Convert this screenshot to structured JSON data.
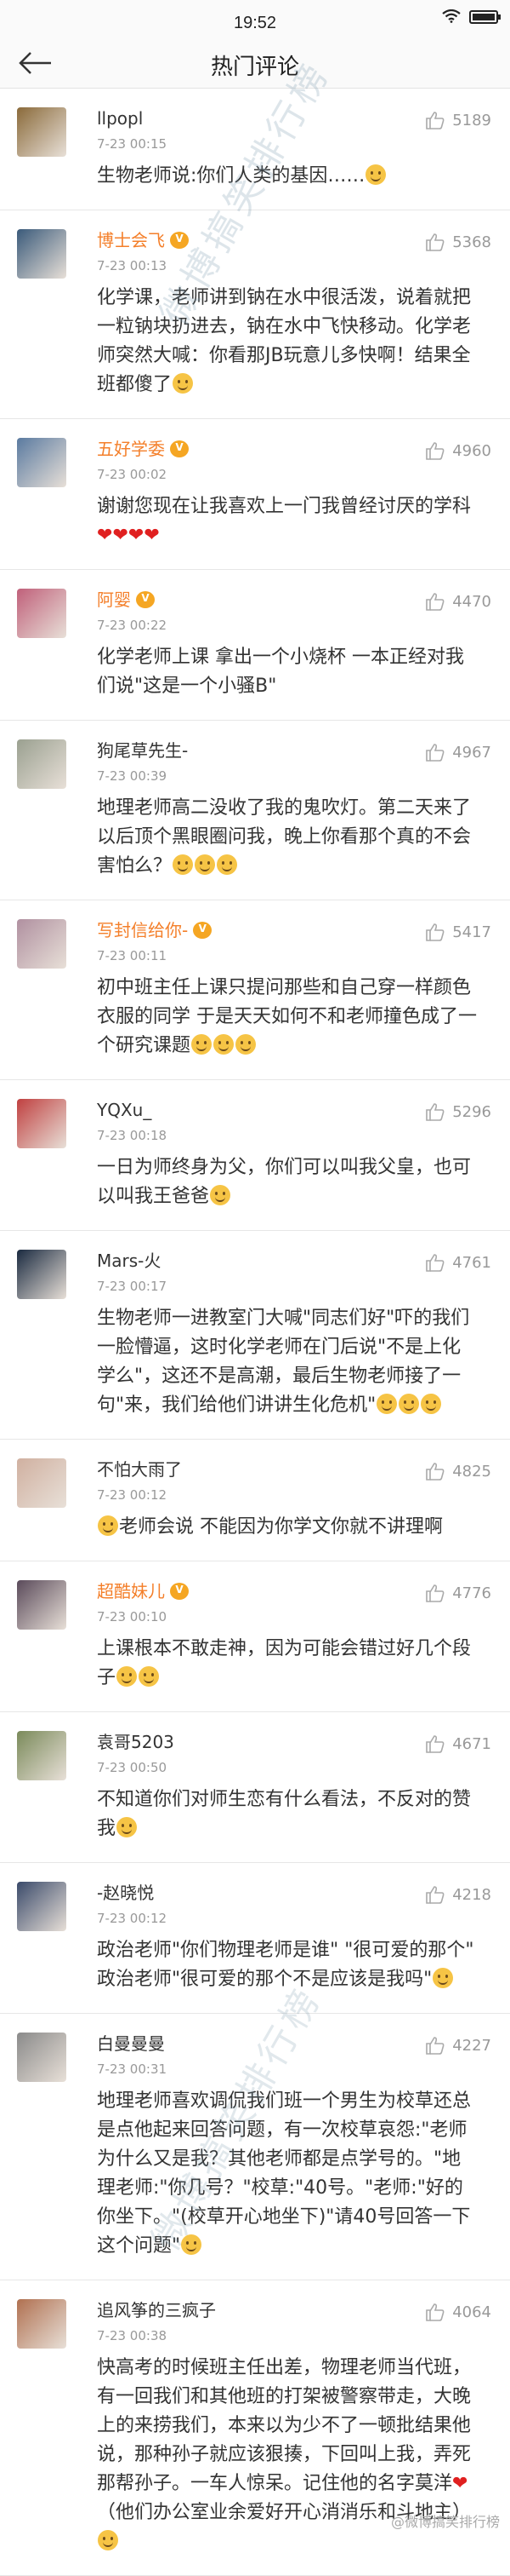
{
  "status": {
    "time": "19:52"
  },
  "header": {
    "title": "热门评论"
  },
  "watermark": {
    "text": "微博搞笑排行榜"
  },
  "footer": {
    "mark": "@微博搞笑排行榜"
  },
  "colors": {
    "vip_name": "#f47f2a",
    "heart": "#e02020"
  },
  "comments": [
    {
      "name": "llpopl",
      "vip": false,
      "time": "7-23 00:15",
      "likes": "5189",
      "text": "生物老师说:你们人类的基因……",
      "emoji_after": 1,
      "avatar_color": "#8a6a3a"
    },
    {
      "name": "博士会飞",
      "vip": true,
      "time": "7-23 00:13",
      "likes": "5368",
      "text": "化学课，老师讲到钠在水中很活泼，说着就把一粒钠块扔进去，钠在水中飞快移动。化学老师突然大喊：你看那JB玩意儿多快啊！结果全班都傻了",
      "emoji_after": 1,
      "avatar_color": "#3a5a7a"
    },
    {
      "name": "五好学委",
      "vip": true,
      "time": "7-23 00:02",
      "likes": "4960",
      "text": "谢谢您现在让我喜欢上一门我曾经讨厌的学科",
      "hearts": 4,
      "avatar_color": "#5a7aa0"
    },
    {
      "name": "阿婴",
      "vip": true,
      "time": "7-23 00:22",
      "likes": "4470",
      "text": "化学老师上课    拿出一个小烧杯    一本正经对我们说\"这是一个小骚B\"",
      "avatar_color": "#c0607a"
    },
    {
      "name": "狗尾草先生-",
      "vip": false,
      "time": "7-23 00:39",
      "likes": "4967",
      "text": "地理老师高二没收了我的鬼吹灯。第二天来了以后顶个黑眼圈问我，晚上你看那个真的不会害怕么？",
      "emoji_after": 3,
      "avatar_color": "#9aa090"
    },
    {
      "name": "写封信给你-",
      "vip": true,
      "time": "7-23 00:11",
      "likes": "5417",
      "text": "初中班主任上课只提问那些和自己穿一样颜色衣服的同学 于是天天如何不和老师撞色成了一个研究课题",
      "emoji_after": 3,
      "avatar_color": "#b090a0"
    },
    {
      "name": "YQXu_",
      "vip": false,
      "time": "7-23 00:18",
      "likes": "5296",
      "text": "一日为师终身为父，你们可以叫我父皇，也可以叫我王爸爸",
      "emoji_after": 1,
      "avatar_color": "#c04040"
    },
    {
      "name": "Mars-火",
      "vip": false,
      "time": "7-23 00:17",
      "likes": "4761",
      "text": "生物老师一进教室门大喊\"同志们好\"吓的我们一脸懵逼，这时化学老师在门后说\"不是上化学么\"，这还不是高潮，最后生物老师接了一句\"来，我们给他们讲讲生化危机\"",
      "emoji_after": 3,
      "avatar_color": "#1a2a40"
    },
    {
      "name": "不怕大雨了",
      "vip": false,
      "time": "7-23 00:12",
      "likes": "4825",
      "text": "老师会说 不能因为你学文你就不讲理啊",
      "emoji_before": 1,
      "avatar_color": "#d0b0a0"
    },
    {
      "name": "超酷妹儿",
      "vip": true,
      "time": "7-23 00:10",
      "likes": "4776",
      "text": "上课根本不敢走神，因为可能会错过好几个段子",
      "emoji_after": 2,
      "avatar_color": "#5a4a5a"
    },
    {
      "name": "袁哥5203",
      "vip": false,
      "time": "7-23 00:50",
      "likes": "4671",
      "text": "不知道你们对师生恋有什么看法，不反对的赞我",
      "emoji_after": 1,
      "avatar_color": "#7a8a5a"
    },
    {
      "name": "-赵晓悦",
      "vip": false,
      "time": "7-23 00:12",
      "likes": "4218",
      "text": "政治老师\"你们物理老师是谁\" \"很可爱的那个\" 政治老师\"很可爱的那个不是应该是我吗\"",
      "emoji_after": 1,
      "avatar_color": "#3a4a6a"
    },
    {
      "name": "白曼曼曼",
      "vip": false,
      "time": "7-23 00:31",
      "likes": "4227",
      "text": "地理老师喜欢调侃我们班一个男生为校草还总是点他起来回答问题，有一次校草哀怨:\"老师为什么又是我？其他老师都是点学号的。\"地理老师:\"你几号？\"校草:\"40号。\"老师:\"好的你坐下。\"(校草开心地坐下)\"请40号回答一下这个问题\"",
      "emoji_after": 1,
      "avatar_color": "#8a8a8a"
    },
    {
      "name": "追风筝的三疯子",
      "vip": false,
      "time": "7-23 00:38",
      "likes": "4064",
      "text": "快高考的时候班主任出差，物理老师当代班，有一回我们和其他班的打架被警察带走，大晚上的来捞我们，本来以为少不了一顿批结果他说，那种孙子就应该狠揍，下回叫上我，弄死那帮孙子。一车人惊呆。记住他的名字莫洋",
      "tail": "（他们办公室业余爱好开心消消乐和斗地主）",
      "hearts_mid": 1,
      "emoji_after": 1,
      "avatar_color": "#b07050"
    }
  ]
}
